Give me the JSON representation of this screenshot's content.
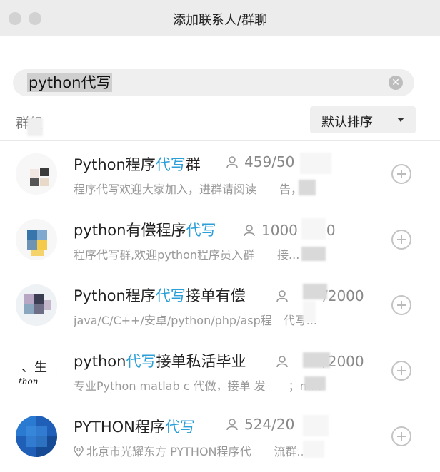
{
  "window": {
    "title": "添加联系人/群聊"
  },
  "search": {
    "query": "python代写"
  },
  "section": {
    "label": "群组"
  },
  "sort": {
    "label": "默认排序"
  },
  "results": [
    {
      "name_pre": "Python程序",
      "name_hl": "代写",
      "name_post": "群",
      "members": "459/50",
      "desc": "程序代写欢迎大家加入，进群请阅读　　告，..."
    },
    {
      "name_pre": "python有偿程序",
      "name_hl": "代写",
      "name_post": "",
      "members": "1000　　0",
      "desc": "程序代写群,欢迎python程序员入群　　接..."
    },
    {
      "name_pre": "Python程序",
      "name_hl": "代写",
      "name_post": "接单有偿",
      "members": "　　/2000",
      "desc": "java/C/C++/安卓/python/php/asp程　代写..."
    },
    {
      "name_pre": "python",
      "name_hl": "代写",
      "name_post": "接单私活毕业",
      "members": "　　/2000",
      "desc": "专业Python matlab c 代做，接单 发　　；m..."
    },
    {
      "name_pre": "PYTHON程序",
      "name_hl": "代写",
      "name_post": "",
      "members": "524/20",
      "desc": "北京市光耀东方  PYTHON程序代　　流群..."
    }
  ],
  "icons": {
    "members": "person-icon",
    "location": "location-pin-icon",
    "add": "plus-circle-icon",
    "clear": "clear-icon",
    "sort": "caret-down-icon"
  },
  "colors": {
    "highlight": "#2c9fd9",
    "titlebar": "#ececec"
  }
}
